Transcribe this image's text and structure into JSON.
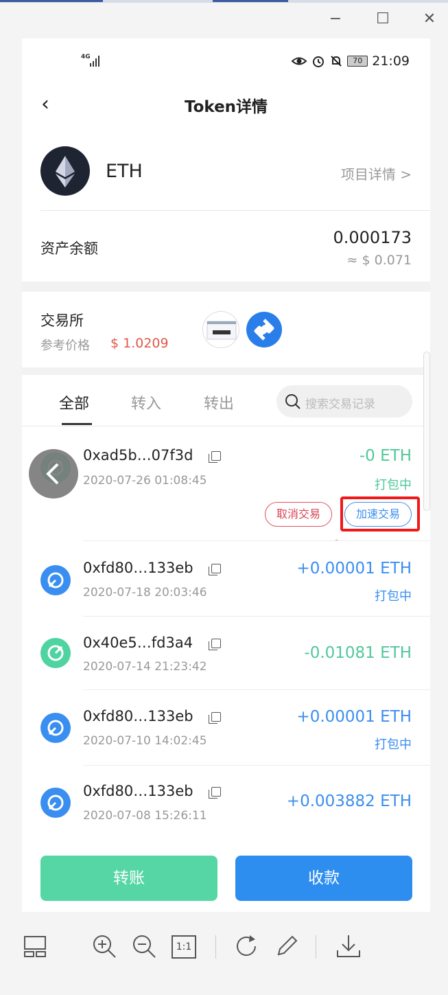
{
  "window": {
    "minimize_glyph": "−",
    "maximize_glyph": "☐",
    "close_glyph": "✕"
  },
  "statusbar": {
    "network": "4G",
    "battery": "70",
    "time": "21:09",
    "icons": [
      "eye-icon",
      "alarm-icon",
      "bell-off-icon",
      "battery-icon"
    ]
  },
  "header": {
    "back_glyph": "‹",
    "title": "Token详情"
  },
  "token": {
    "symbol": "ETH",
    "project_link": "项目详情 >"
  },
  "balance": {
    "label": "资产余额",
    "amount": "0.000173",
    "usd": "≈ $ 0.071"
  },
  "exchange": {
    "label": "交易所",
    "ref_label": "参考价格",
    "ref_price": "$ 1.0209"
  },
  "tabs": [
    {
      "label": "全部",
      "active": true
    },
    {
      "label": "转入",
      "active": false
    },
    {
      "label": "转出",
      "active": false
    }
  ],
  "search": {
    "placeholder": "搜索交易记录"
  },
  "transactions": [
    {
      "hash": "0xad5b…07f3d",
      "date": "2020-07-26 01:08:45",
      "amount": "-0 ETH",
      "status": "打包中",
      "direction": "out"
    },
    {
      "hash": "0xfd80…133eb",
      "date": "2020-07-18 20:03:46",
      "amount": "+0.00001 ETH",
      "status": "打包中",
      "direction": "in"
    },
    {
      "hash": "0x40e5…fd3a4",
      "date": "2020-07-14 21:23:42",
      "amount": "-0.01081 ETH",
      "status": "",
      "direction": "out"
    },
    {
      "hash": "0xfd80…133eb",
      "date": "2020-07-10 14:02:45",
      "amount": "+0.00001 ETH",
      "status": "打包中",
      "direction": "in"
    },
    {
      "hash": "0xfd80…133eb",
      "date": "2020-07-08 15:26:11",
      "amount": "+0.003882 ETH",
      "status": "",
      "direction": "in"
    }
  ],
  "tx_actions": {
    "cancel": "取消交易",
    "speed_up": "加速交易"
  },
  "bottom": {
    "transfer": "转账",
    "receive": "收款"
  },
  "colors": {
    "green": "#4fc89a",
    "blue": "#3a8ef0",
    "red": "#e0584a",
    "highlight": "#f01818"
  },
  "viewer_toolbar": [
    "thumbnails-icon",
    "zoom-in-icon",
    "zoom-out-icon",
    "actual-size-icon",
    "rotate-icon",
    "edit-icon",
    "download-icon"
  ],
  "viewer": {
    "actual_size_label": "1:1"
  }
}
